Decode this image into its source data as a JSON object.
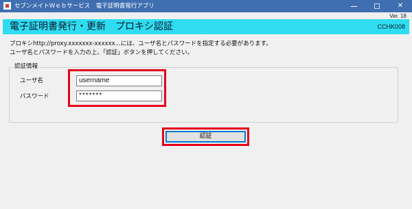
{
  "window": {
    "title": "セブンメイトＷｅｂサービス　電子証明書発行アプリ",
    "controls": {
      "minimize": "",
      "maximize": "",
      "close": "✕"
    }
  },
  "version": "Ver. 18",
  "header": {
    "title": "電子証明書発行・更新　プロキシ認証",
    "screen_id": "CCHK008",
    "color": "#30dcf0"
  },
  "message": {
    "line1": "プロキシhttp://proxy.xxxxxxx-xxxxxx...には、ユーザ名とパスワードを指定する必要があります。",
    "line2": "ユーザ名とパスワードを入力の上、「認証」ボタンを押してください。"
  },
  "auth_group": {
    "legend": "認証情報",
    "username_label": "ユーザ名",
    "username_value": "username",
    "password_label": "パスワード",
    "password_value": "*******"
  },
  "auth_button": {
    "label": "認証"
  },
  "highlight_color": "#e5001b"
}
